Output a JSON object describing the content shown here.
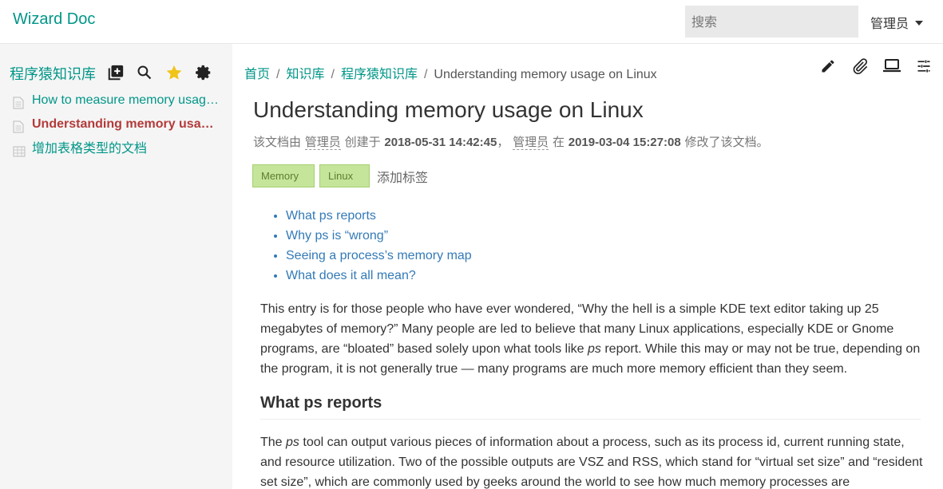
{
  "navbar": {
    "brand": "Wizard Doc",
    "search_placeholder": "搜索",
    "user": "管理员"
  },
  "sidebar": {
    "title": "程序猿知识库",
    "items": [
      {
        "label": "How to measure memory usag…",
        "icon": "document-icon"
      },
      {
        "label": "Understanding memory usa…",
        "icon": "document-icon",
        "active": true
      },
      {
        "label": "增加表格类型的文档",
        "icon": "table-icon"
      }
    ]
  },
  "breadcrumb": [
    "首页",
    "知识库",
    "程序猿知识库",
    "Understanding memory usage on Linux"
  ],
  "document": {
    "title": "Understanding memory usage on Linux",
    "meta": {
      "prefix": "该文档由",
      "creator": "管理员",
      "created_label": "创建于",
      "created_at": "2018-05-31 14:42:45",
      "comma": "，",
      "modifier": "管理员",
      "modified_label": "在",
      "modified_at": "2019-03-04 15:27:08",
      "suffix": "修改了该文档。"
    },
    "tags": [
      "Memory",
      "Linux"
    ],
    "add_tag": "添加标签",
    "toc": [
      "What ps reports",
      "Why ps is “wrong”",
      "Seeing a process’s memory map",
      "What does it all mean?"
    ],
    "para1": {
      "a": "This entry is for those people who have ever wondered, “Why the hell is a simple KDE text editor taking up 25 megabytes of memory?” Many people are led to believe that many Linux applications, especially KDE or Gnome programs, are “bloated” based solely upon what tools like ",
      "em": "ps",
      "b": " report. While this may or may not be true, depending on the program, it is not generally true — many programs are much more memory efficient than they seem."
    },
    "heading": "What ps reports",
    "para2": {
      "a": "The ",
      "em": "ps",
      "b": " tool can output various pieces of information about a process, such as its process id, current running state, and resource utilization. Two of the possible outputs are VSZ and RSS, which stand for “virtual set size” and “resident set size”, which are commonly used by geeks around the world to see how much memory processes are"
    }
  },
  "colors": {
    "brand": "#009688",
    "active": "#b33a3a",
    "link": "#337ab7",
    "tag_bg": "#c5e59b",
    "star": "#f0c419"
  }
}
